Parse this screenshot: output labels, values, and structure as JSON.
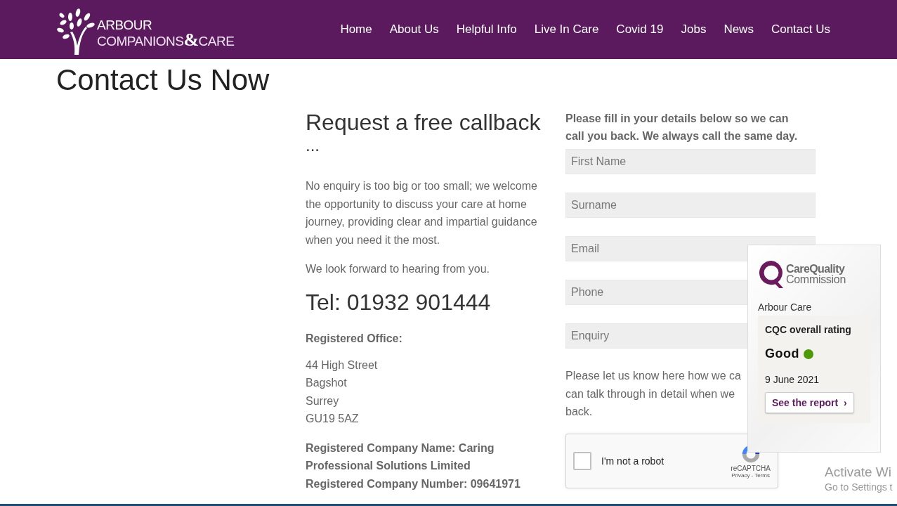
{
  "logo": {
    "line1": "ARBOUR",
    "line2a": "COMPANIONS",
    "amp": "&",
    "line2b": "CARE"
  },
  "nav": [
    {
      "label": "Home"
    },
    {
      "label": "About Us"
    },
    {
      "label": "Helpful Info"
    },
    {
      "label": "Live In Care"
    },
    {
      "label": "Covid 19"
    },
    {
      "label": "Jobs"
    },
    {
      "label": "News"
    },
    {
      "label": "Contact Us"
    }
  ],
  "page_title": "Contact Us Now",
  "callback": {
    "heading": "Request a free callback",
    "ellipsis": "...",
    "paragraphs": [
      "No enquiry is too big or too small; we welcome the opportunity to discuss your care at home journey, providing clear and impartial guidance when you need it the most.",
      "We look forward to hearing from you."
    ],
    "phone": "Tel: 01932 901444",
    "office_label": "Registered Office:",
    "address": [
      "44 High Street",
      "Bagshot",
      "Surrey",
      "GU19 5AZ"
    ],
    "company_name": "Registered Company Name: Caring Professional Solutions Limited",
    "company_number": "Registered Company Number: 09641971"
  },
  "form": {
    "intro": "Please fill in your details below so we can call you back. We always call the same day.",
    "fields": [
      {
        "placeholder": "First Name"
      },
      {
        "placeholder": "Surname"
      },
      {
        "placeholder": "Email"
      },
      {
        "placeholder": "Phone"
      },
      {
        "placeholder": "Enquiry"
      }
    ],
    "note_lines": [
      "Please let us know here how we ca",
      "can talk through in detail when we",
      "back."
    ],
    "captcha": {
      "label": "I'm not a robot",
      "checked": false,
      "brand": "reCAPTCHA",
      "privacy": "Privacy",
      "sep": "-",
      "terms": "Terms"
    }
  },
  "cqc": {
    "logo_line1": "CareQuality",
    "logo_line2": "Commission",
    "provider": "Arbour Care",
    "rating_label": "CQC overall rating",
    "rating": "Good",
    "color": "#4e9a06",
    "date": "9 June 2021",
    "button": "See the report",
    "button_icon": "›"
  },
  "os_notice": {
    "title": "Activate Wi",
    "subtitle": "Go to Settings t"
  }
}
